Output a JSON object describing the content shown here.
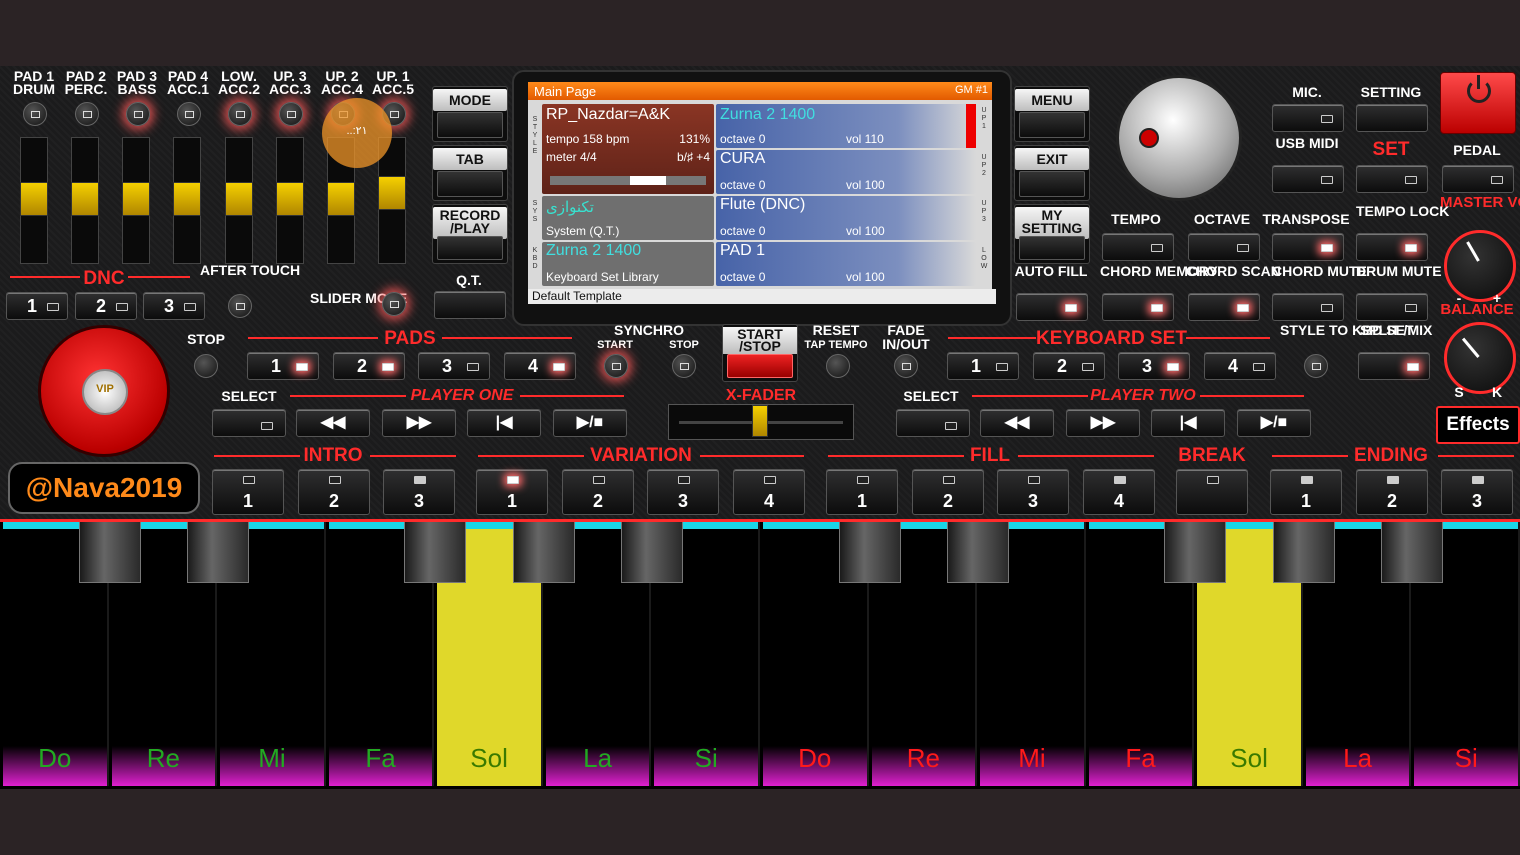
{
  "colors": {
    "accent": "#ff2b2b",
    "fader": "#f5d000",
    "note_green": "#22aa22",
    "note_red": "#ff1a1a",
    "pressed": "#e0d82a"
  },
  "pads": {
    "labels": [
      {
        "top": "PAD 1",
        "bottom": "DRUM"
      },
      {
        "top": "PAD 2",
        "bottom": "PERC."
      },
      {
        "top": "PAD 3",
        "bottom": "BASS"
      },
      {
        "top": "PAD 4",
        "bottom": "ACC.1"
      },
      {
        "top": "LOW.",
        "bottom": "ACC.2"
      },
      {
        "top": "UP. 3",
        "bottom": "ACC.3"
      },
      {
        "top": "UP. 2",
        "bottom": "ACC.4"
      },
      {
        "top": "UP. 1",
        "bottom": "ACC.5"
      }
    ],
    "overlay_text": "..:٢١"
  },
  "dnc": {
    "title": "DNC",
    "buttons": [
      "1",
      "2",
      "3"
    ],
    "after_touch": "AFTER TOUCH",
    "slider_mode": "SLIDER MODE"
  },
  "left_buttons": {
    "mode": "MODE",
    "tab": "TAB",
    "record": "RECORD /PLAY",
    "qt": "Q.T."
  },
  "right_buttons": {
    "menu": "MENU",
    "exit": "EXIT",
    "my_setting": "MY SETTING",
    "auto_fill": "AUTO FILL"
  },
  "screen": {
    "header": "Main Page",
    "gm": "GM #1",
    "style_name": "RP_Nazdar=A&K",
    "tempo": "tempo 158 bpm",
    "percent": "131%",
    "meter": "meter 4/4",
    "key": "b/♯ +4",
    "system_name": "تکنوازی",
    "system_sub": "System (Q.T.)",
    "kbd_name": "Zurna 2 1400",
    "kbd_sub": "Keyboard Set Library",
    "side_left": {
      "style": "S T Y L E",
      "sys": "S Y S",
      "kbd": "K B D"
    },
    "side_right": {
      "up1": "U P 1",
      "up2": "U P 2",
      "up3": "U P 3",
      "low": "L O W"
    },
    "tracks": [
      {
        "name": "Zurna 2 1400",
        "octave": "octave  0",
        "vol": "vol 110"
      },
      {
        "name": "CURA",
        "octave": "octave  0",
        "vol": "vol 100"
      },
      {
        "name": "Flute (DNC)",
        "octave": "octave  0",
        "vol": "vol 100"
      },
      {
        "name": "PAD 1",
        "octave": "octave  0",
        "vol": "vol 100"
      }
    ],
    "footer": "Default Template"
  },
  "top_right": {
    "mic": "MIC.",
    "setting": "SETTING",
    "usb_midi": "USB MIDI",
    "set": "SET",
    "pedal": "PEDAL",
    "master_volume": "MASTER VOLUME",
    "tempo": "TEMPO",
    "octave": "OCTAVE",
    "transpose": "TRANSPOSE",
    "tempo_lock": "TEMPO LOCK",
    "chord_memory": "CHORD MEMORY",
    "chord_scan": "CHORD SCAN",
    "chord_mute": "CHORD MUTE",
    "drum_mute": "DRUM MUTE",
    "balance": "BALANCE",
    "minus": "-",
    "plus": "+",
    "s": "S",
    "k": "K",
    "style_to_kbd": "STYLE TO KBD SET",
    "split_mix": "SPLIT /MIX",
    "effects": "Effects"
  },
  "middle": {
    "stop": "STOP",
    "pads": "PADS",
    "pad_buttons": [
      "1",
      "2",
      "3",
      "4"
    ],
    "synchro": "SYNCHRO",
    "sync_start": "START",
    "sync_stop": "STOP",
    "start_stop": "START /STOP",
    "reset": "RESET",
    "tap_tempo": "TAP TEMPO",
    "fade": "FADE",
    "in_out": "IN/OUT",
    "keyboard_set": "KEYBOARD SET",
    "kbd_buttons": [
      "1",
      "2",
      "3",
      "4"
    ]
  },
  "players": {
    "select_left": "SELECT",
    "player_one": "PLAYER ONE",
    "select_right": "SELECT",
    "player_two": "PLAYER TWO",
    "x_fader": "X-FADER",
    "transport": [
      "◀◀",
      "▶▶",
      "|◀",
      "▶/■"
    ]
  },
  "sections": {
    "intro": {
      "label": "INTRO",
      "buttons": [
        "1",
        "2",
        "3"
      ]
    },
    "variation": {
      "label": "VARIATION",
      "buttons": [
        "1",
        "2",
        "3",
        "4"
      ]
    },
    "fill": {
      "label": "FILL",
      "buttons": [
        "1",
        "2",
        "3",
        "4"
      ]
    },
    "break": {
      "label": "BREAK"
    },
    "ending": {
      "label": "ENDING",
      "buttons": [
        "1",
        "2",
        "3"
      ]
    }
  },
  "brand": {
    "handle": "@Nava2019",
    "vip": "VIP"
  },
  "keyboard": {
    "notes": [
      "Do",
      "Re",
      "Mi",
      "Fa",
      "Sol",
      "La",
      "Si",
      "Do",
      "Re",
      "Mi",
      "Fa",
      "Sol",
      "La",
      "Si"
    ],
    "pressed": [
      4,
      11
    ]
  }
}
